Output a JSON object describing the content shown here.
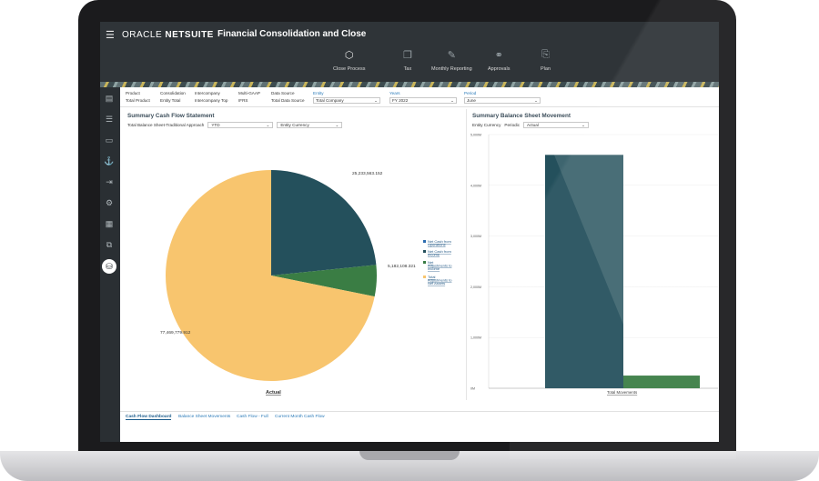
{
  "header": {
    "menu_icon": "hamburger-icon",
    "brand_oracle": "ORACLE",
    "brand_netsuite": "NETSUITE",
    "title": "Financial Consolidation and Close"
  },
  "nav": [
    {
      "label": "Close Process",
      "icon": "cube-icon"
    },
    {
      "label": "Tax",
      "icon": "documents-icon"
    },
    {
      "label": "Monthly Reporting",
      "icon": "pencil-icon"
    },
    {
      "label": "Approvals",
      "icon": "hierarchy-icon"
    },
    {
      "label": "Plan",
      "icon": "plan-icon"
    }
  ],
  "pov": {
    "product_label": "Product",
    "product_value": "Total Product",
    "consolidation_label": "Consolidation",
    "consolidation_value": "Entity Total",
    "intercompany_label": "Intercompany",
    "intercompany_value": "Intercompany Top",
    "multigaap_label": "Multi-GAAP",
    "multigaap_value": "IFRS",
    "datasource_label": "Data Source",
    "datasource_value": "Total Data Source",
    "entity_label": "Entity",
    "entity_value": "Total Company",
    "years_label": "Years",
    "years_value": "FY 2022",
    "period_label": "Period",
    "period_value": "June"
  },
  "left_panel": {
    "title": "Summary Cash Flow Statement",
    "filter1": "Total Balance Sheet-Traditional Approach",
    "filter2": "YTD",
    "filter3": "Entity Currency",
    "slice_labels": [
      "25,233,563.152",
      "5,182,108.321",
      "77,469,779.912"
    ],
    "axis_label": "Actual",
    "legend": [
      "Net Cash from Operations",
      "Net Cash from Income",
      "Net Adjustments to Income",
      "Total Adjustments to Net Assets"
    ]
  },
  "right_panel": {
    "title": "Summary Balance Sheet Movement",
    "filter1": "Entity Currency",
    "filter2": "Periodic",
    "filter3": "Actual",
    "x_label": "Total Movements"
  },
  "tabs": [
    "Cash Flow Dashboard",
    "Balance Sheet Movements",
    "Cash Flow - Full",
    "Current Month Cash Flow"
  ],
  "colors": {
    "teal": "#24505c",
    "green": "#3a7d44",
    "peach": "#f8c56e",
    "link": "#2b7bb9"
  },
  "chart_data": [
    {
      "type": "pie",
      "title": "Summary Cash Flow Statement",
      "xlabel": "Actual",
      "slices": [
        {
          "name": "Net Cash from Income",
          "value": 25233563.152,
          "color": "#24505c"
        },
        {
          "name": "Net Adjustments to Income",
          "value": 5182108.321,
          "color": "#3a7d44"
        },
        {
          "name": "Total Adjustments to Net Assets",
          "value": 77469779.912,
          "color": "#f8c56e"
        }
      ],
      "legend": [
        "Net Cash from Operations",
        "Net Cash from Income",
        "Net Adjustments to Income",
        "Total Adjustments to Net Assets"
      ]
    },
    {
      "type": "bar",
      "title": "Summary Balance Sheet Movement",
      "categories": [
        "Total Movements"
      ],
      "series": [
        {
          "values": [
            4.6
          ],
          "color": "#24505c"
        },
        {
          "values": [
            0.25
          ],
          "color": "#3a7d44"
        }
      ],
      "ylim": [
        0,
        5
      ],
      "yticks": [
        "0M",
        "1,000M",
        "2,000M",
        "3,000M",
        "4,000M",
        "5,000M"
      ],
      "grid": true
    }
  ]
}
